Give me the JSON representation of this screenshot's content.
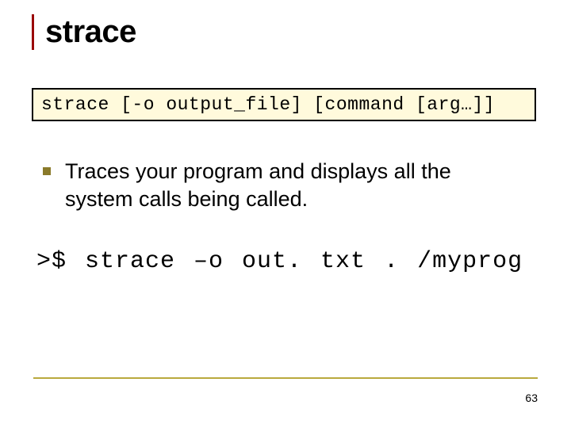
{
  "title": "strace",
  "syntax": "strace [-o output_file] [command [arg…]]",
  "bullet": "Traces your program and displays all the system calls being called.",
  "example": ">$ strace –o out. txt . /myprog",
  "pageNumber": "63"
}
